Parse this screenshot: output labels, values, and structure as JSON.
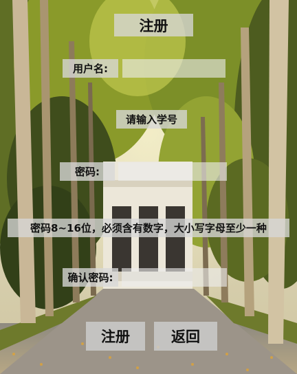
{
  "page": {
    "title": "注册"
  },
  "form": {
    "username_label": "用户名:",
    "username_value": "",
    "username_hint": "请输入学号",
    "password_label": "密码:",
    "password_value": "",
    "password_hint": "密码8~16位，必须含有数字，大小写字母至少一种",
    "confirm_label": "确认密码:",
    "confirm_value": ""
  },
  "buttons": {
    "register": "注册",
    "back": "返回"
  },
  "background": {
    "description_icon": "campus-avenue-photo"
  }
}
